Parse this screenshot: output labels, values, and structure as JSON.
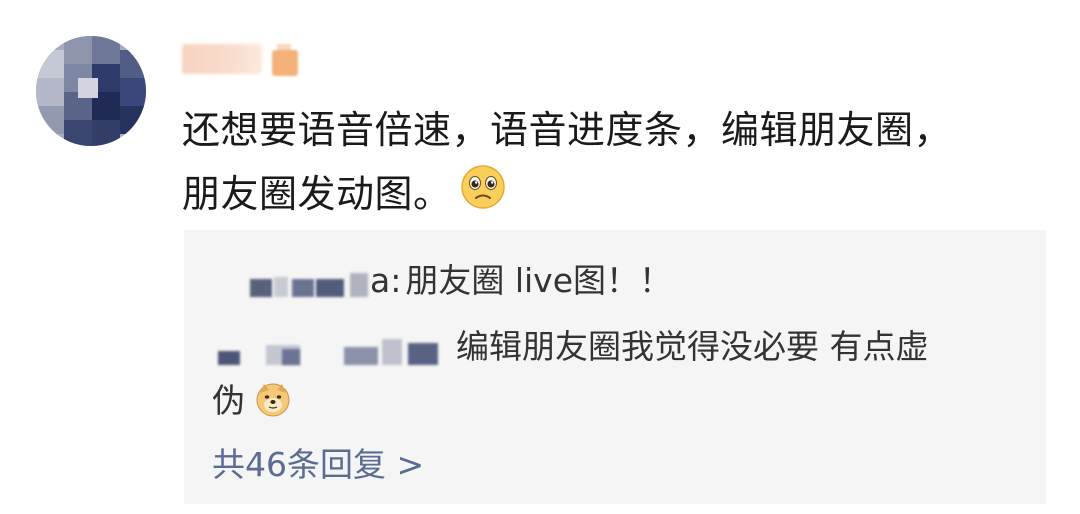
{
  "comment": {
    "text_line1": "还想要语音倍速，语音进度条，编辑朋友圈，",
    "text_line2": "朋友圈发动图。",
    "emoji_icon": "pleading-face-emoji"
  },
  "replies": [
    {
      "name_suffix": "a:",
      "text": "朋友圈 live图！！"
    },
    {
      "text_line1": "编辑朋友圈我觉得没必要 有点虚",
      "text_line2": "伪",
      "emoji_icon": "doge-emoji"
    }
  ],
  "more_replies": {
    "label": "共46条回复 >"
  },
  "colors": {
    "reply_bg": "#f5f5f5",
    "link": "#5b6b93",
    "text": "#1a1a1a"
  }
}
